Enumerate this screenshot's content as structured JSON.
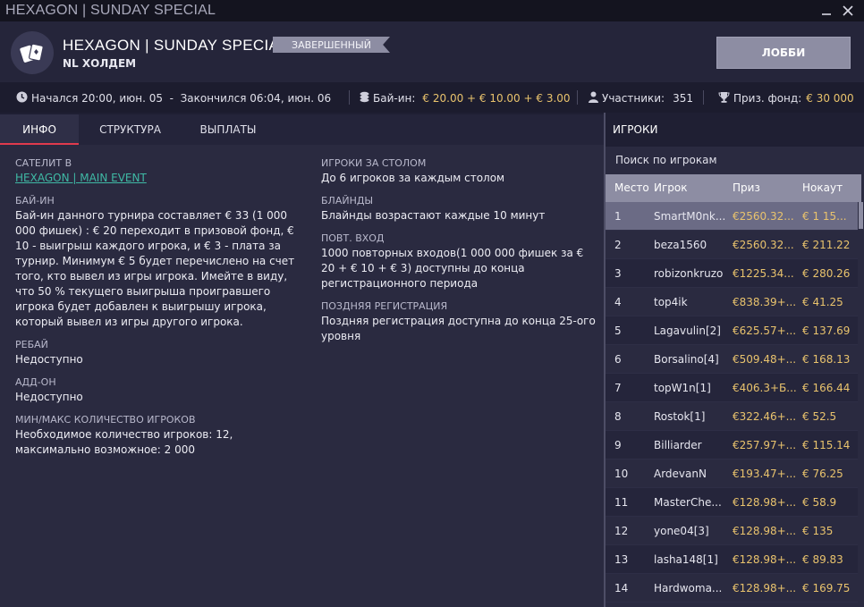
{
  "window": {
    "title": "HEXAGON | SUNDAY SPECIAL"
  },
  "header": {
    "title": "HEXAGON | SUNDAY SPECIAL",
    "game": "NL ХОЛДЕМ",
    "status": "ЗАВЕРШЕННЫЙ",
    "lobby_button": "ЛОББИ"
  },
  "infobar": {
    "time": "Начался 20:00, июн. 05  -  Закончился 06:04, июн. 06",
    "buyin_label": "Бай-ин:",
    "buyin_value": "€ 20.00 + € 10.00 + € 3.00",
    "participants_label": "Участники:",
    "participants_value": "351",
    "prize_label": "Приз. фонд:",
    "prize_value": "€ 30 000"
  },
  "tabs": [
    "ИНФО",
    "СТРУКТУРА",
    "ВЫПЛАТЫ"
  ],
  "info_left": [
    {
      "title": "САТЕЛИТ В",
      "body": "",
      "link": "HEXAGON | MAIN EVENT"
    },
    {
      "title": "БАЙ-ИН",
      "body": "Бай-ин данного турнира составляет € 33 (1 000 000 фишек) : € 20 переходит в призовой фонд, € 10 - выигрыш каждого игрока, и € 3 - плата за турнир. Минимум € 5 будет перечислено на счет того, кто вывел из игры игрока. Имейте в виду, что 50 % текущего выигрыша проигравшего игрока будет добавлен к выигрышу игрока, который вывел из игры другого игрока."
    },
    {
      "title": "РЕБАЙ",
      "body": "Недоступно"
    },
    {
      "title": "АДД-ОН",
      "body": "Недоступно"
    },
    {
      "title": "МИН/МАКС КОЛИЧЕСТВО ИГРОКОВ",
      "body": "Необходимое количество игроков: 12, максимально возможное: 2 000"
    }
  ],
  "info_right": [
    {
      "title": "ИГРОКИ ЗА СТОЛОМ",
      "body": "До 6 игроков за каждым столом"
    },
    {
      "title": "БЛАЙНДЫ",
      "body": "Блайнды возрастают каждые 10 минут"
    },
    {
      "title": "ПОВТ. ВХОД",
      "body": "1000 повторных входов(1 000 000 фишек за € 20 + € 10 + € 3) доступны до конца регистрационного периода"
    },
    {
      "title": "ПОЗДНЯЯ РЕГИСТРАЦИЯ",
      "body": "Поздняя регистрация доступна до конца 25-ого уровня"
    }
  ],
  "players": {
    "header": "ИГРОКИ",
    "search_placeholder": "Поиск по игрокам",
    "columns": [
      "Место",
      "Игрок",
      "Приз",
      "Нокаут"
    ],
    "rows": [
      {
        "place": "1",
        "player": "SmartM0nk...",
        "prize": "€2560.32...",
        "knockout": "€ 1 15..."
      },
      {
        "place": "2",
        "player": "beza1560",
        "prize": "€2560.32...",
        "knockout": "€ 211.22"
      },
      {
        "place": "3",
        "player": "robizonkruzo",
        "prize": "€1225.34...",
        "knockout": "€ 280.26"
      },
      {
        "place": "4",
        "player": "top4ik",
        "prize": "€838.39+...",
        "knockout": "€ 41.25"
      },
      {
        "place": "5",
        "player": "Lagavulin[2]",
        "prize": "€625.57+...",
        "knockout": "€ 137.69"
      },
      {
        "place": "6",
        "player": "Borsalino[4]",
        "prize": "€509.48+...",
        "knockout": "€ 168.13"
      },
      {
        "place": "7",
        "player": "topW1n[1]",
        "prize": "€406.3+Б...",
        "knockout": "€ 166.44"
      },
      {
        "place": "8",
        "player": "Rostok[1]",
        "prize": "€322.46+...",
        "knockout": "€ 52.5"
      },
      {
        "place": "9",
        "player": "Billiarder",
        "prize": "€257.97+...",
        "knockout": "€ 115.14"
      },
      {
        "place": "10",
        "player": "ArdevanN",
        "prize": "€193.47+...",
        "knockout": "€ 76.25"
      },
      {
        "place": "11",
        "player": "MasterChe...",
        "prize": "€128.98+...",
        "knockout": "€ 58.9"
      },
      {
        "place": "12",
        "player": "yone04[3]",
        "prize": "€128.98+...",
        "knockout": "€ 135"
      },
      {
        "place": "13",
        "player": "lasha148[1]",
        "prize": "€128.98+...",
        "knockout": "€ 89.83"
      },
      {
        "place": "14",
        "player": "Hardwoma...",
        "prize": "€128.98+...",
        "knockout": "€ 169.75"
      }
    ]
  },
  "colors": {
    "accent_red": "#e03a4d",
    "gold": "#e9c36d",
    "link_teal": "#3fb9a5",
    "badge_gray": "#8d8da3"
  }
}
